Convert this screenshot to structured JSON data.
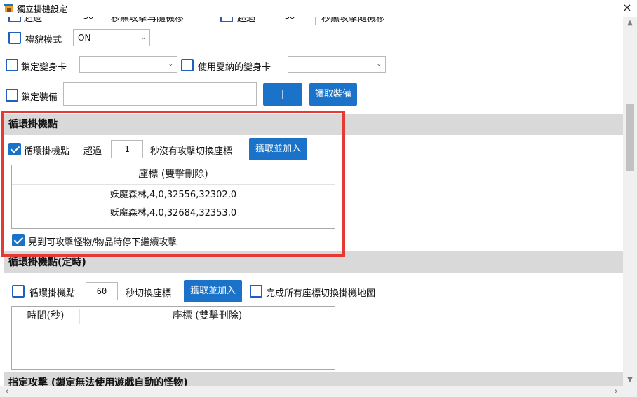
{
  "window": {
    "title": "獨立掛機設定",
    "close": "×"
  },
  "top_row": {
    "label1": "超過",
    "value1": "30",
    "text1": "秒無攻擊再隨機移",
    "label2": "超過",
    "value2": "30",
    "text2": "秒無攻擊隨機移"
  },
  "etiquette": {
    "label": "禮貌模式",
    "value": "ON",
    "checked": false
  },
  "morph": {
    "lock_label": "鎖定變身卡",
    "lock_value": "",
    "summer_label": "使用夏納的變身卡",
    "summer_value": ""
  },
  "equip": {
    "lock_label": "鎖定裝備",
    "value": "",
    "pipe_button": "|",
    "read_button": "讀取裝備"
  },
  "loop_points": {
    "header": "循環掛機點",
    "enable_label": "循環掛機點",
    "enabled": true,
    "exceed_label": "超過",
    "seconds": "1",
    "switch_text": "秒沒有攻擊切換座標",
    "fetch_button": "獲取並加入",
    "grid_header": "座標 (雙擊刪除)",
    "rows": [
      "妖魔森林,4,0,32556,32302,0",
      "妖魔森林,4,0,32684,32353,0"
    ],
    "stop_label": "見到可攻擊怪物/物品時停下繼續攻擊",
    "stop_checked": true
  },
  "timed_points": {
    "header": "循環掛機點(定時)",
    "enable_label": "循環掛機點",
    "enabled": false,
    "seconds": "60",
    "switch_text": "秒切換座標",
    "fetch_button": "獲取並加入",
    "complete_label": "完成所有座標切換掛機地圖",
    "complete_checked": false,
    "col_time": "時間(秒)",
    "col_coord": "座標 (雙擊刪除)"
  },
  "assign_attack": {
    "header": "指定攻擊 (鎖定無法使用遊戲自動的怪物)"
  },
  "colors": {
    "accent": "#1a73c8",
    "highlight_frame": "#e53935",
    "section_bg": "#d9d9d9"
  },
  "scrollbars": {
    "up": "▲",
    "down": "▼",
    "left": "‹",
    "right": "›"
  }
}
